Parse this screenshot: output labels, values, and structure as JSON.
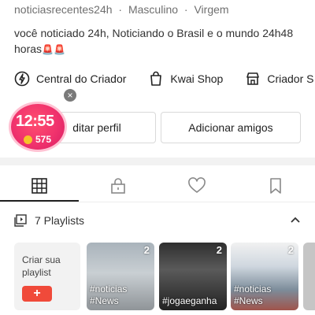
{
  "profile": {
    "info": {
      "handle": "noticiasrecentes24h",
      "separator": "·",
      "gender": "Masculino",
      "sign": "Virgem"
    },
    "bio": "você noticiado 24h, Noticiando o Brasil e o mundo 24h48 horas",
    "bio_emojis": "🚨🚨"
  },
  "quick_links": [
    {
      "label": "Central do Criador",
      "icon": "lightning-circle-icon"
    },
    {
      "label": "Kwai Shop",
      "icon": "shopping-bag-icon"
    },
    {
      "label": "Criador S",
      "icon": "store-icon"
    }
  ],
  "actions": {
    "edit_profile": "ditar perfil",
    "add_friends": "Adicionar amigos"
  },
  "clock_badge": {
    "time": "12:55",
    "coins": "575",
    "close": "×"
  },
  "tabs": [
    {
      "name": "grid",
      "icon": "grid-icon",
      "active": true
    },
    {
      "name": "private",
      "icon": "lock-icon",
      "active": false
    },
    {
      "name": "likes",
      "icon": "heart-icon",
      "active": false
    },
    {
      "name": "saved",
      "icon": "bookmark-icon",
      "active": false
    }
  ],
  "playlists": {
    "title": "7 Playlists",
    "create_label": "Criar sua playlist",
    "create_button": "+",
    "items": [
      {
        "count": "2",
        "tags": [
          "#noticias",
          "#News"
        ]
      },
      {
        "count": "2",
        "tags": [
          "#jogaeganha"
        ]
      },
      {
        "count": "2",
        "tags": [
          "#noticias",
          "#News"
        ]
      },
      {
        "count": "",
        "tags": []
      }
    ]
  },
  "colors": {
    "accent": "#f04a3a",
    "badge_pink": "#f0326d",
    "coin": "#f6c329"
  }
}
